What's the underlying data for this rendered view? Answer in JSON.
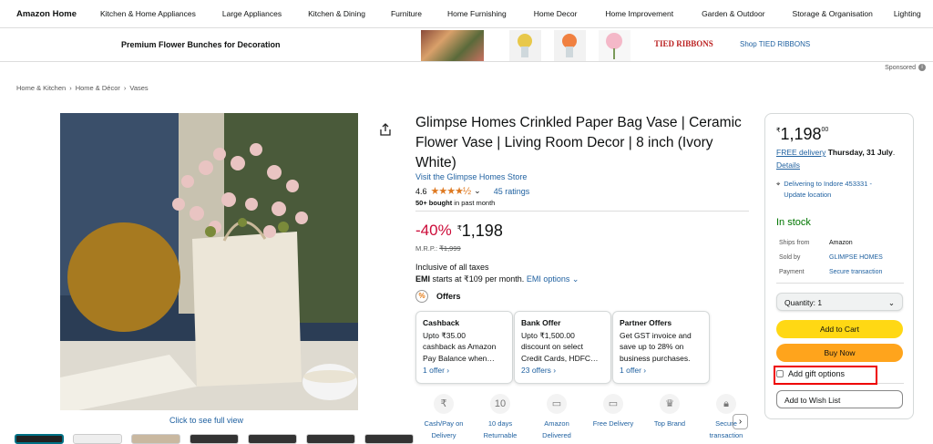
{
  "nav": {
    "brand": "Amazon Home",
    "items": [
      "Kitchen & Home Appliances",
      "Large Appliances",
      "Kitchen & Dining",
      "Furniture",
      "Home Furnishing",
      "Home Decor",
      "Home Improvement",
      "Garden & Outdoor",
      "Storage & Organisation",
      "Lighting"
    ]
  },
  "ad": {
    "title": "Premium Flower Bunches for Decoration",
    "brand_logo": "TIED RIBBONS",
    "shop_link": "Shop TIED RIBBONS",
    "sponsored": "Sponsored"
  },
  "breadcrumb": [
    "Home & Kitchen",
    "Home & Décor",
    "Vases"
  ],
  "product": {
    "title": "Glimpse Homes Crinkled Paper Bag Vase | Ceramic Flower Vase | Living Room Decor | 8 inch (Ivory White)",
    "store_link": "Visit the Glimpse Homes Store",
    "rating": "4.6",
    "stars": "★★★★½",
    "ratings_count": "45 ratings",
    "bought_bold": "50+ bought",
    "bought_rest": " in past month",
    "discount": "-40%",
    "currency": "₹",
    "price": "1,198",
    "mrp_label": "M.R.P.:",
    "mrp": "₹1,999",
    "taxes": "Inclusive of all taxes",
    "emi_bold": "EMI",
    "emi_text": " starts at ₹109 per month.",
    "emi_link": "EMI options",
    "full_view": "Click to see full view"
  },
  "offers": {
    "heading": "Offers",
    "cards": [
      {
        "title": "Cashback",
        "lines": [
          "Upto ₹35.00",
          "cashback as Amazon",
          "Pay Balance when…"
        ],
        "link": "1 offer ›"
      },
      {
        "title": "Bank Offer",
        "lines": [
          "Upto ₹1,500.00",
          "discount on select",
          "Credit Cards, HDFC…"
        ],
        "link": "23 offers ›"
      },
      {
        "title": "Partner Offers",
        "lines": [
          "Get GST invoice and",
          "save up to 28% on",
          "business purchases."
        ],
        "link": "1 offer ›"
      }
    ]
  },
  "features": [
    {
      "l1": "Cash/Pay on",
      "l2": "Delivery"
    },
    {
      "l1": "10 days",
      "l2": "Returnable"
    },
    {
      "l1": "Amazon",
      "l2": "Delivered"
    },
    {
      "l1": "Free Delivery",
      "l2": ""
    },
    {
      "l1": "Top Brand",
      "l2": ""
    },
    {
      "l1": "Secure",
      "l2": "transaction"
    }
  ],
  "buybox": {
    "currency": "₹",
    "price": "1,198",
    "price_fraction": "00",
    "free_delivery": "FREE delivery",
    "delivery_date": " Thursday, 31 July",
    "details": "Details",
    "location": "Delivering to Indore 453331 - Update location",
    "stock": "In stock",
    "ships_from_label": "Ships from",
    "ships_from": "Amazon",
    "sold_by_label": "Sold by",
    "sold_by": "GLIMPSE HOMES",
    "payment_label": "Payment",
    "payment": "Secure transaction",
    "quantity": "Quantity: 1",
    "add_to_cart": "Add to Cart",
    "buy_now": "Buy Now",
    "gift": "Add gift options",
    "wishlist": "Add to Wish List"
  }
}
